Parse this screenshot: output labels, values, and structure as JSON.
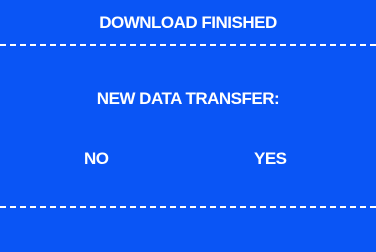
{
  "dialog": {
    "title": "DOWNLOAD FINISHED",
    "prompt": "NEW DATA TRANSFER:",
    "options": {
      "no": "NO",
      "yes": "YES"
    }
  },
  "colors": {
    "background": "#0a55f5",
    "text": "#ffffff"
  }
}
